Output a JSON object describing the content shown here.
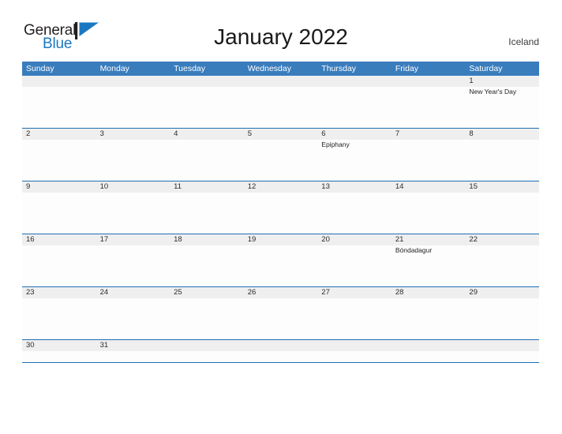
{
  "brand": {
    "name_part1": "General",
    "name_part2": "Blue",
    "mark_icon": "flag-triangle-icon",
    "color_dark": "#231f20",
    "color_blue": "#1a78c2"
  },
  "header": {
    "title": "January 2022",
    "country": "Iceland"
  },
  "theme": {
    "header_blue": "#3a7dbd",
    "rule_blue": "#1f6fb2",
    "date_strip_gray": "#efefef",
    "cell_white": "#fdfdfd"
  },
  "calendar": {
    "month": "January",
    "year": "2022",
    "weekday_headers": [
      "Sunday",
      "Monday",
      "Tuesday",
      "Wednesday",
      "Thursday",
      "Friday",
      "Saturday"
    ],
    "weeks": [
      {
        "days": [
          {
            "num": "",
            "events": []
          },
          {
            "num": "",
            "events": []
          },
          {
            "num": "",
            "events": []
          },
          {
            "num": "",
            "events": []
          },
          {
            "num": "",
            "events": []
          },
          {
            "num": "",
            "events": []
          },
          {
            "num": "1",
            "events": [
              "New Year's Day"
            ]
          }
        ]
      },
      {
        "days": [
          {
            "num": "2",
            "events": []
          },
          {
            "num": "3",
            "events": []
          },
          {
            "num": "4",
            "events": []
          },
          {
            "num": "5",
            "events": []
          },
          {
            "num": "6",
            "events": [
              "Epiphany"
            ]
          },
          {
            "num": "7",
            "events": []
          },
          {
            "num": "8",
            "events": []
          }
        ]
      },
      {
        "days": [
          {
            "num": "9",
            "events": []
          },
          {
            "num": "10",
            "events": []
          },
          {
            "num": "11",
            "events": []
          },
          {
            "num": "12",
            "events": []
          },
          {
            "num": "13",
            "events": []
          },
          {
            "num": "14",
            "events": []
          },
          {
            "num": "15",
            "events": []
          }
        ]
      },
      {
        "days": [
          {
            "num": "16",
            "events": []
          },
          {
            "num": "17",
            "events": []
          },
          {
            "num": "18",
            "events": []
          },
          {
            "num": "19",
            "events": []
          },
          {
            "num": "20",
            "events": []
          },
          {
            "num": "21",
            "events": [
              "Bóndadagur"
            ]
          },
          {
            "num": "22",
            "events": []
          }
        ]
      },
      {
        "days": [
          {
            "num": "23",
            "events": []
          },
          {
            "num": "24",
            "events": []
          },
          {
            "num": "25",
            "events": []
          },
          {
            "num": "26",
            "events": []
          },
          {
            "num": "27",
            "events": []
          },
          {
            "num": "28",
            "events": []
          },
          {
            "num": "29",
            "events": []
          }
        ]
      },
      {
        "days": [
          {
            "num": "30",
            "events": []
          },
          {
            "num": "31",
            "events": []
          },
          {
            "num": "",
            "events": []
          },
          {
            "num": "",
            "events": []
          },
          {
            "num": "",
            "events": []
          },
          {
            "num": "",
            "events": []
          },
          {
            "num": "",
            "events": []
          }
        ]
      }
    ]
  }
}
